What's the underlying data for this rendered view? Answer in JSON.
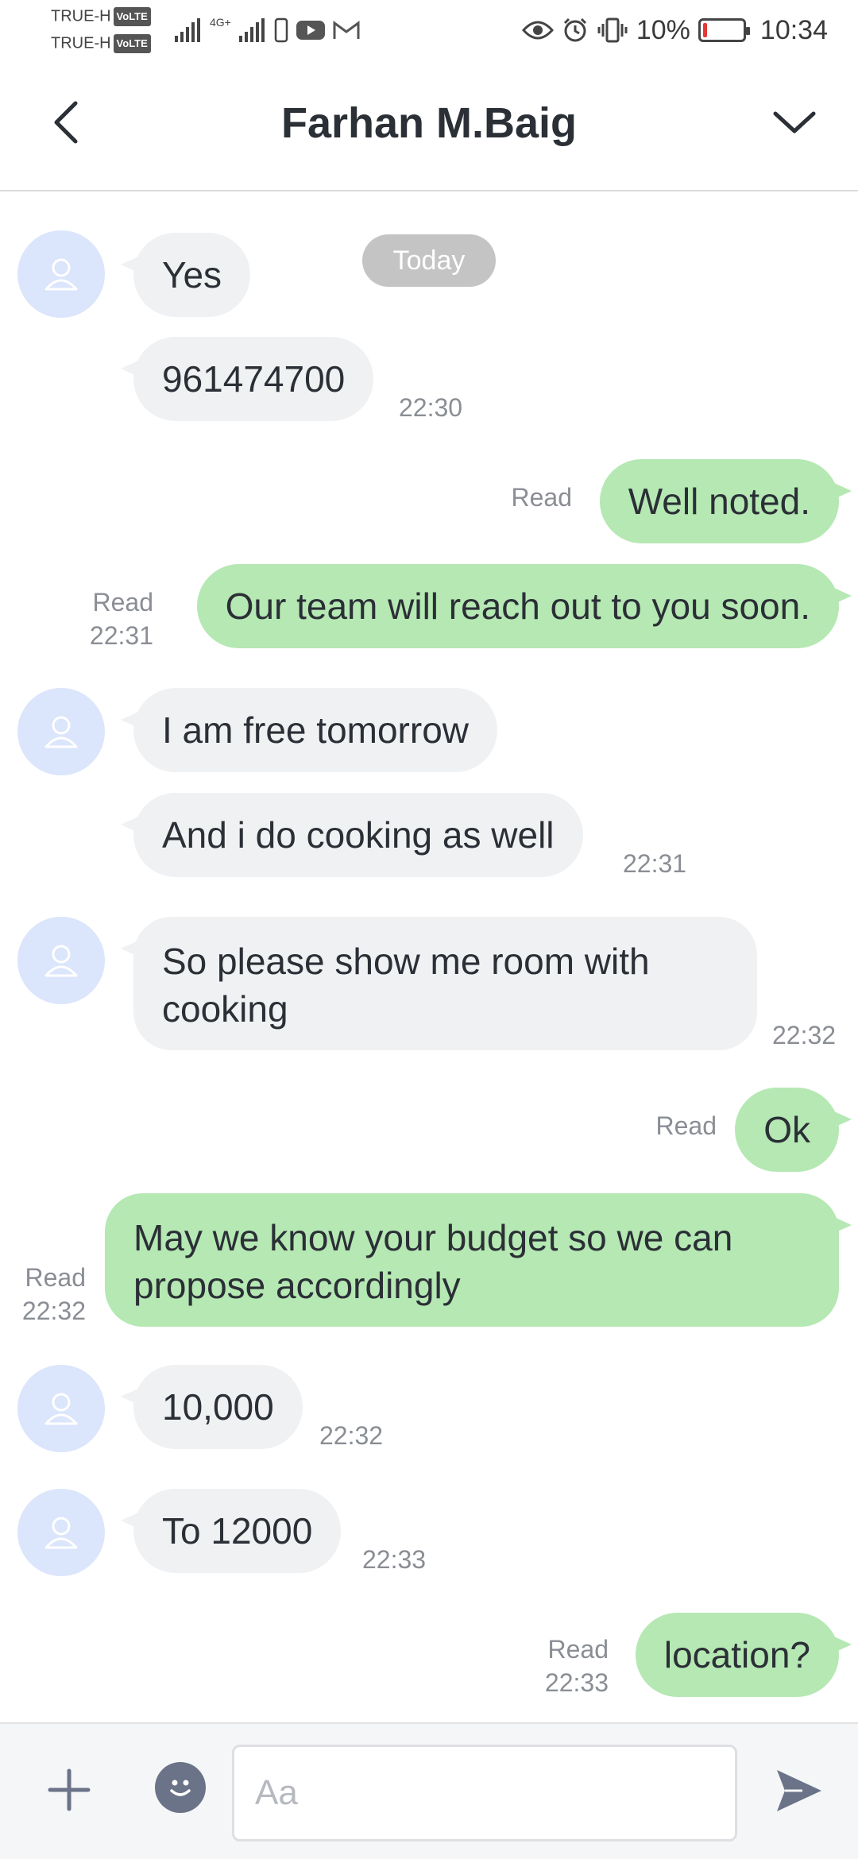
{
  "status_bar": {
    "carrier1": "TRUE-H",
    "carrier2": "TRUE-H",
    "volte": "VoLTE",
    "network": "4G+",
    "battery": "10%",
    "battery_level": 0.1,
    "time": "10:34"
  },
  "header": {
    "title": "Farhan M.Baig",
    "back_icon": "chevron-left-icon",
    "expand_icon": "chevron-down-icon"
  },
  "chat": {
    "date_divider": "Today",
    "colors": {
      "incoming": "#f0f1f3",
      "outgoing": "#b5e8b3",
      "avatar": "#dbe5fb"
    },
    "messages": [
      {
        "dir": "in",
        "text": "Yes"
      },
      {
        "dir": "in",
        "text": "961474700",
        "time": "22:30"
      },
      {
        "dir": "out",
        "text": "Well noted.",
        "status": "Read"
      },
      {
        "dir": "out",
        "text": "Our team will reach out to you soon.",
        "status": "Read",
        "time": "22:31"
      },
      {
        "dir": "in",
        "text": "I am free tomorrow"
      },
      {
        "dir": "in",
        "text": "And i do cooking as well",
        "time": "22:31"
      },
      {
        "dir": "in",
        "text_line1": "So please show me room with",
        "text_line2": "cooking",
        "time": "22:32"
      },
      {
        "dir": "out",
        "text": "Ok",
        "status": "Read"
      },
      {
        "dir": "out",
        "text_line1": "May we know your budget so we can",
        "text_line2": "propose accordingly",
        "status": "Read",
        "time": "22:32"
      },
      {
        "dir": "in",
        "text": "10,000",
        "time": "22:32"
      },
      {
        "dir": "in",
        "text": "To 12000",
        "time": "22:33"
      },
      {
        "dir": "out",
        "text": "location?",
        "status": "Read",
        "time": "22:33"
      }
    ]
  },
  "input_bar": {
    "placeholder": "Aa",
    "value": "",
    "plus_icon": "plus-icon",
    "emoji_icon": "emoji-icon",
    "send_icon": "send-icon"
  }
}
